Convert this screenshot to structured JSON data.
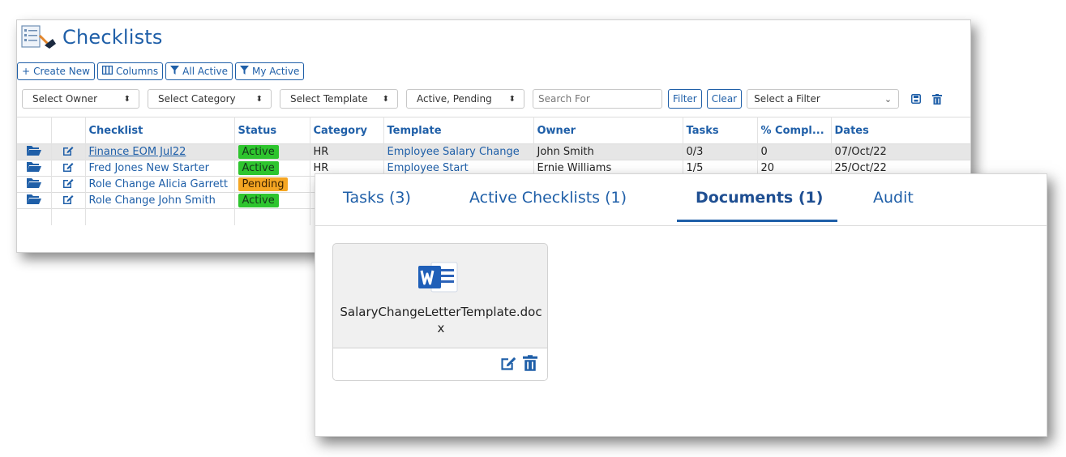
{
  "list": {
    "title": "Checklists",
    "toolbar": {
      "create": "Create New",
      "columns": "Columns",
      "all_active": "All Active",
      "my_active": "My Active"
    },
    "filters": {
      "owner": "Select Owner",
      "category": "Select Category",
      "template": "Select Template",
      "status": "Active, Pending",
      "search_placeholder": "Search For",
      "filter_btn": "Filter",
      "clear_btn": "Clear",
      "saved_filter": "Select a Filter"
    },
    "columns": [
      "Checklist",
      "Status",
      "Category",
      "Template",
      "Owner",
      "Tasks",
      "% Compl...",
      "Dates"
    ],
    "rows": [
      {
        "checklist": "Finance EOM Jul22",
        "status": "Active",
        "category": "HR",
        "template": "Employee Salary Change",
        "owner": "John Smith",
        "tasks": "0/3",
        "pct": "0",
        "date": "07/Oct/22"
      },
      {
        "checklist": "Fred Jones New Starter",
        "status": "Active",
        "category": "HR",
        "template": "Employee Start",
        "owner": "Ernie Williams",
        "tasks": "1/5",
        "pct": "20",
        "date": "25/Oct/22"
      },
      {
        "checklist": "Role Change Alicia Garrett",
        "status": "Pending",
        "category": "",
        "template": "",
        "owner": "",
        "tasks": "",
        "pct": "",
        "date": ""
      },
      {
        "checklist": "Role Change John Smith",
        "status": "Active",
        "category": "",
        "template": "",
        "owner": "",
        "tasks": "",
        "pct": "",
        "date": ""
      }
    ]
  },
  "detail": {
    "tabs": [
      {
        "label": "Tasks (3)"
      },
      {
        "label": "Active Checklists (1)"
      },
      {
        "label": "Documents (1)"
      },
      {
        "label": "Audit"
      }
    ],
    "document": {
      "name": "SalaryChangeLetterTemplate.docx",
      "icon": "word-document-icon"
    }
  },
  "colors": {
    "accent": "#1f5fa8",
    "active": "#2ec52e",
    "pending": "#f5a623"
  }
}
